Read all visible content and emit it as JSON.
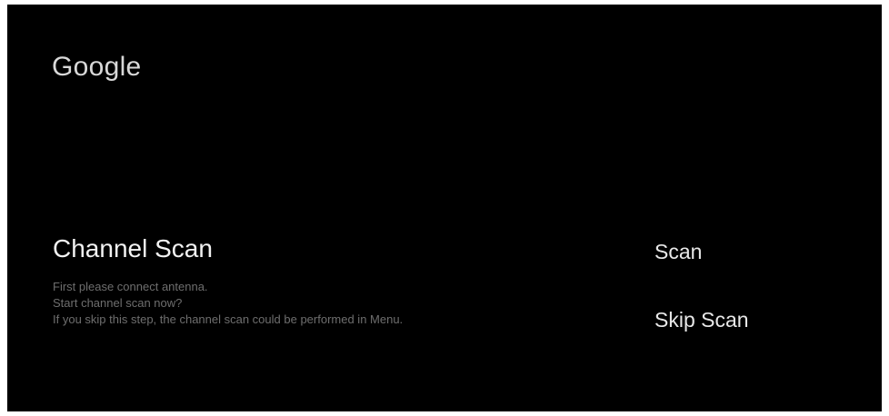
{
  "brand": {
    "name": "Google"
  },
  "channel_scan": {
    "title": "Channel Scan",
    "description": [
      "First please connect antenna.",
      "Start channel scan now?",
      "If you skip this step, the channel scan could be performed in Menu."
    ]
  },
  "actions": [
    {
      "label": "Scan"
    },
    {
      "label": "Skip Scan"
    }
  ],
  "colors": {
    "background": "#000000",
    "title_text": "#f2f2f2",
    "description_text": "#6e6e6e",
    "action_text": "#e8e8e8"
  }
}
